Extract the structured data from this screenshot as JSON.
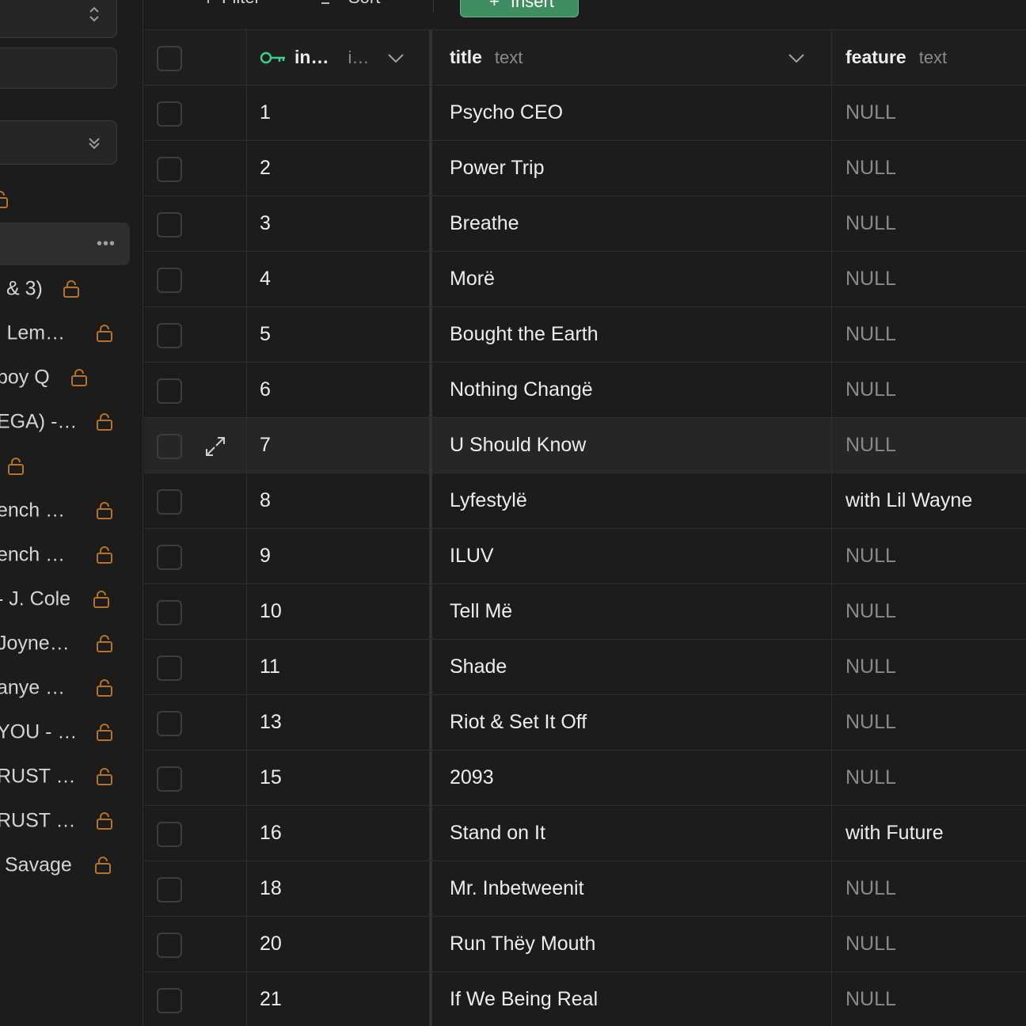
{
  "toolbar": {
    "filter_label": "Filter",
    "sort_label": "Sort",
    "insert_label": "Insert"
  },
  "sidebar": {
    "items": [
      {
        "label": "& 3)"
      },
      {
        "label": "l Lem…"
      },
      {
        "label": "boy Q"
      },
      {
        "label": "EGA) -…"
      },
      {
        "label": ""
      },
      {
        "label": "ench …"
      },
      {
        "label": "ench …"
      },
      {
        "label": "- J. Cole"
      },
      {
        "label": "Joyne…"
      },
      {
        "label": "anye …"
      },
      {
        "label": "YOU - …"
      },
      {
        "label": "RUST …"
      },
      {
        "label": "RUST …"
      },
      {
        "label": "Savage"
      }
    ]
  },
  "grid": {
    "columns": [
      {
        "name": "in…",
        "type": "i…"
      },
      {
        "name": "title",
        "type": "text"
      },
      {
        "name": "feature",
        "type": "text"
      }
    ],
    "rows": [
      {
        "id": "1",
        "title": "Psycho CEO",
        "feature": "NULL"
      },
      {
        "id": "2",
        "title": "Power Trip",
        "feature": "NULL"
      },
      {
        "id": "3",
        "title": "Breathe",
        "feature": "NULL"
      },
      {
        "id": "4",
        "title": "Morë",
        "feature": "NULL"
      },
      {
        "id": "5",
        "title": "Bought the Earth",
        "feature": "NULL"
      },
      {
        "id": "6",
        "title": "Nothing Changë",
        "feature": "NULL"
      },
      {
        "id": "7",
        "title": "U Should Know",
        "feature": "NULL"
      },
      {
        "id": "8",
        "title": "Lyfestylë",
        "feature": "with Lil Wayne"
      },
      {
        "id": "9",
        "title": "ILUV",
        "feature": "NULL"
      },
      {
        "id": "10",
        "title": "Tell Më",
        "feature": "NULL"
      },
      {
        "id": "11",
        "title": "Shade",
        "feature": "NULL"
      },
      {
        "id": "13",
        "title": "Riot & Set It Off",
        "feature": "NULL"
      },
      {
        "id": "15",
        "title": "2093",
        "feature": "NULL"
      },
      {
        "id": "16",
        "title": "Stand on It",
        "feature": "with Future"
      },
      {
        "id": "18",
        "title": "Mr. Inbetweenit",
        "feature": "NULL"
      },
      {
        "id": "20",
        "title": "Run Thëy Mouth",
        "feature": "NULL"
      },
      {
        "id": "21",
        "title": "If We Being Real",
        "feature": "NULL"
      }
    ]
  },
  "colors": {
    "background": "#1c1c1c",
    "accent_green": "#3e8e62",
    "lock_orange": "#b3742a",
    "null_text": "#8a8a8a"
  },
  "icons": {
    "primary_key": "key-icon",
    "lock": "unlock-icon",
    "expand": "expand-icon",
    "chevron": "chevron-down-icon",
    "more": "more-icon"
  }
}
